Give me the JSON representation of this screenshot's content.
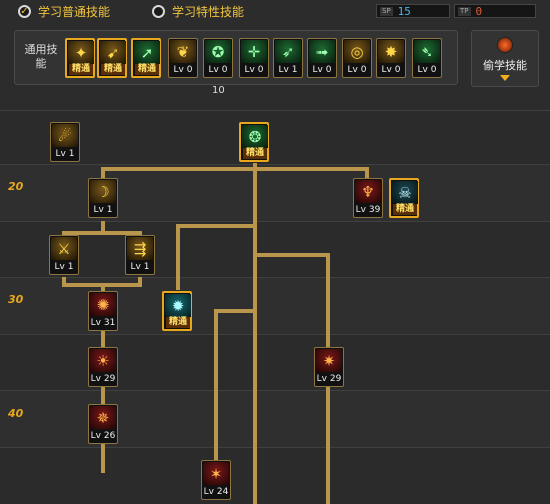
{
  "tabs": [
    {
      "label": "学习普通技能",
      "selected": true,
      "icon": "check-icon"
    },
    {
      "label": "学习特性技能",
      "selected": false,
      "icon": "radio-empty-icon"
    }
  ],
  "points": [
    {
      "tag": "SP",
      "value": "15",
      "color": "#4fb6e8"
    },
    {
      "tag": "TP",
      "value": "0",
      "color": "#e05a3a"
    }
  ],
  "common_skills": {
    "label": "通用技能",
    "items": [
      {
        "lv": "精通",
        "mastered": true,
        "icon": "scroll-icon",
        "color": "gold"
      },
      {
        "lv": "精通",
        "mastered": true,
        "icon": "kick-icon",
        "color": "gold"
      },
      {
        "lv": "精通",
        "mastered": true,
        "icon": "run-icon",
        "color": "green"
      },
      {
        "lv": "Lv 0",
        "mastered": false,
        "icon": "wings-icon",
        "color": "gold"
      },
      {
        "lv": "Lv 0",
        "mastered": false,
        "icon": "target-icon",
        "color": "green"
      },
      {
        "lv": "Lv 0",
        "mastered": false,
        "icon": "crosshair-icon",
        "color": "green"
      },
      {
        "lv": "Lv 1",
        "mastered": false,
        "icon": "leap-icon",
        "color": "green"
      },
      {
        "lv": "Lv 0",
        "mastered": false,
        "icon": "dash-icon",
        "color": "green"
      },
      {
        "lv": "Lv 0",
        "mastered": false,
        "icon": "ring-icon",
        "color": "gold"
      },
      {
        "lv": "Lv 0",
        "mastered": false,
        "icon": "burst-icon",
        "color": "gold"
      },
      {
        "lv": "Lv 0",
        "mastered": false,
        "icon": "strike-icon",
        "color": "green"
      }
    ],
    "count": "10"
  },
  "steal_button": {
    "label": "偷学技能",
    "icon": "steal-icon"
  },
  "level_markers": [
    "20",
    "30",
    "40"
  ],
  "tree_nodes": [
    {
      "id": "n1",
      "lv": "Lv 1",
      "mastered": false,
      "icon": "slash-icon",
      "color": "gold"
    },
    {
      "id": "n2",
      "lv": "精通",
      "mastered": true,
      "icon": "wind-icon",
      "color": "green"
    },
    {
      "id": "n3",
      "lv": "Lv 1",
      "mastered": false,
      "icon": "crescent-icon",
      "color": "gold"
    },
    {
      "id": "n4",
      "lv": "Lv 39",
      "mastered": false,
      "icon": "spear-icon",
      "color": "red"
    },
    {
      "id": "n5",
      "lv": "精通",
      "mastered": true,
      "icon": "skull-icon",
      "color": "teal"
    },
    {
      "id": "n6",
      "lv": "Lv 1",
      "mastered": false,
      "icon": "blade-icon",
      "color": "gold"
    },
    {
      "id": "n7",
      "lv": "Lv 1",
      "mastered": false,
      "icon": "multi-arrow-icon",
      "color": "gold"
    },
    {
      "id": "n8",
      "lv": "Lv 31",
      "mastered": false,
      "icon": "swirl-icon",
      "color": "red"
    },
    {
      "id": "n9",
      "lv": "精通",
      "mastered": true,
      "icon": "cyclone-icon",
      "color": "cyan"
    },
    {
      "id": "n10",
      "lv": "Lv 29",
      "mastered": false,
      "icon": "fire-slash-icon",
      "color": "red"
    },
    {
      "id": "n11",
      "lv": "Lv 29",
      "mastered": false,
      "icon": "explosion-icon",
      "color": "red"
    },
    {
      "id": "n12",
      "lv": "Lv 26",
      "mastered": false,
      "icon": "dragon-icon",
      "color": "red"
    },
    {
      "id": "n13",
      "lv": "Lv 24",
      "mastered": false,
      "icon": "flame-wing-icon",
      "color": "red"
    }
  ]
}
